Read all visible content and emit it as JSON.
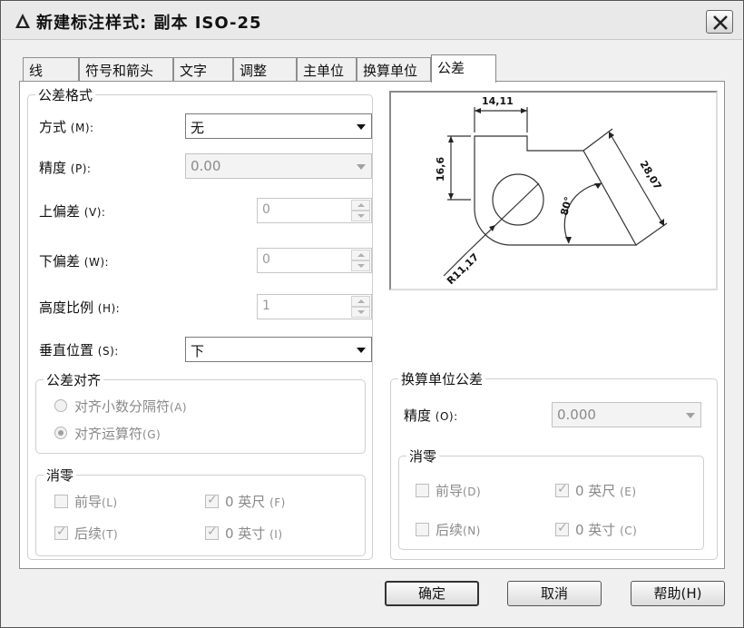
{
  "window": {
    "title": "新建标注样式: 副本 ISO-25"
  },
  "tabs": [
    {
      "label": "线"
    },
    {
      "label": "符号和箭头"
    },
    {
      "label": "文字"
    },
    {
      "label": "调整"
    },
    {
      "label": "主单位"
    },
    {
      "label": "换算单位"
    },
    {
      "label": "公差"
    }
  ],
  "tolerance_format": {
    "legend": "公差格式",
    "method": {
      "label": "方式",
      "hotkey": "(M):",
      "value": "无"
    },
    "precision": {
      "label": "精度",
      "hotkey": "(P):",
      "value": "0.00"
    },
    "upper": {
      "label": "上偏差",
      "hotkey": "(V):",
      "value": "0"
    },
    "lower": {
      "label": "下偏差",
      "hotkey": "(W):",
      "value": "0"
    },
    "height": {
      "label": "高度比例",
      "hotkey": "(H):",
      "value": "1"
    },
    "vertical": {
      "label": "垂直位置",
      "hotkey": "(S):",
      "value": "下"
    }
  },
  "alignment": {
    "legend": "公差对齐",
    "decimal": {
      "label": "对齐小数分隔符",
      "hotkey": "(A)",
      "selected": false
    },
    "operator": {
      "label": "对齐运算符",
      "hotkey": "(G)",
      "selected": true
    }
  },
  "zero_suppression": {
    "legend": "消零",
    "leading": {
      "label": "前导",
      "hotkey": "(L)",
      "checked": false
    },
    "trailing": {
      "label": "后续",
      "hotkey": "(T)",
      "checked": true
    },
    "feet": {
      "label": "0 英尺",
      "hotkey": "(F)",
      "checked": true
    },
    "inches": {
      "label": "0 英寸",
      "hotkey": "(I)",
      "checked": true
    }
  },
  "alt_units": {
    "legend": "换算单位公差",
    "precision": {
      "label": "精度",
      "hotkey": "(O):",
      "value": "0.000"
    },
    "zero_legend": "消零",
    "leading": {
      "label": "前导",
      "hotkey": "(D)",
      "checked": false
    },
    "trailing": {
      "label": "后续",
      "hotkey": "(N)",
      "checked": false
    },
    "feet": {
      "label": "0 英尺",
      "hotkey": "(E)",
      "checked": true
    },
    "inches": {
      "label": "0 英寸",
      "hotkey": "(C)",
      "checked": true
    }
  },
  "preview": {
    "dim_top": "14,11",
    "dim_left": "16,6",
    "dim_right": "28,07",
    "dim_angle": "80°",
    "dim_radius": "R11,17"
  },
  "buttons": {
    "ok": "确定",
    "cancel": "取消",
    "help": "帮助(H)"
  }
}
